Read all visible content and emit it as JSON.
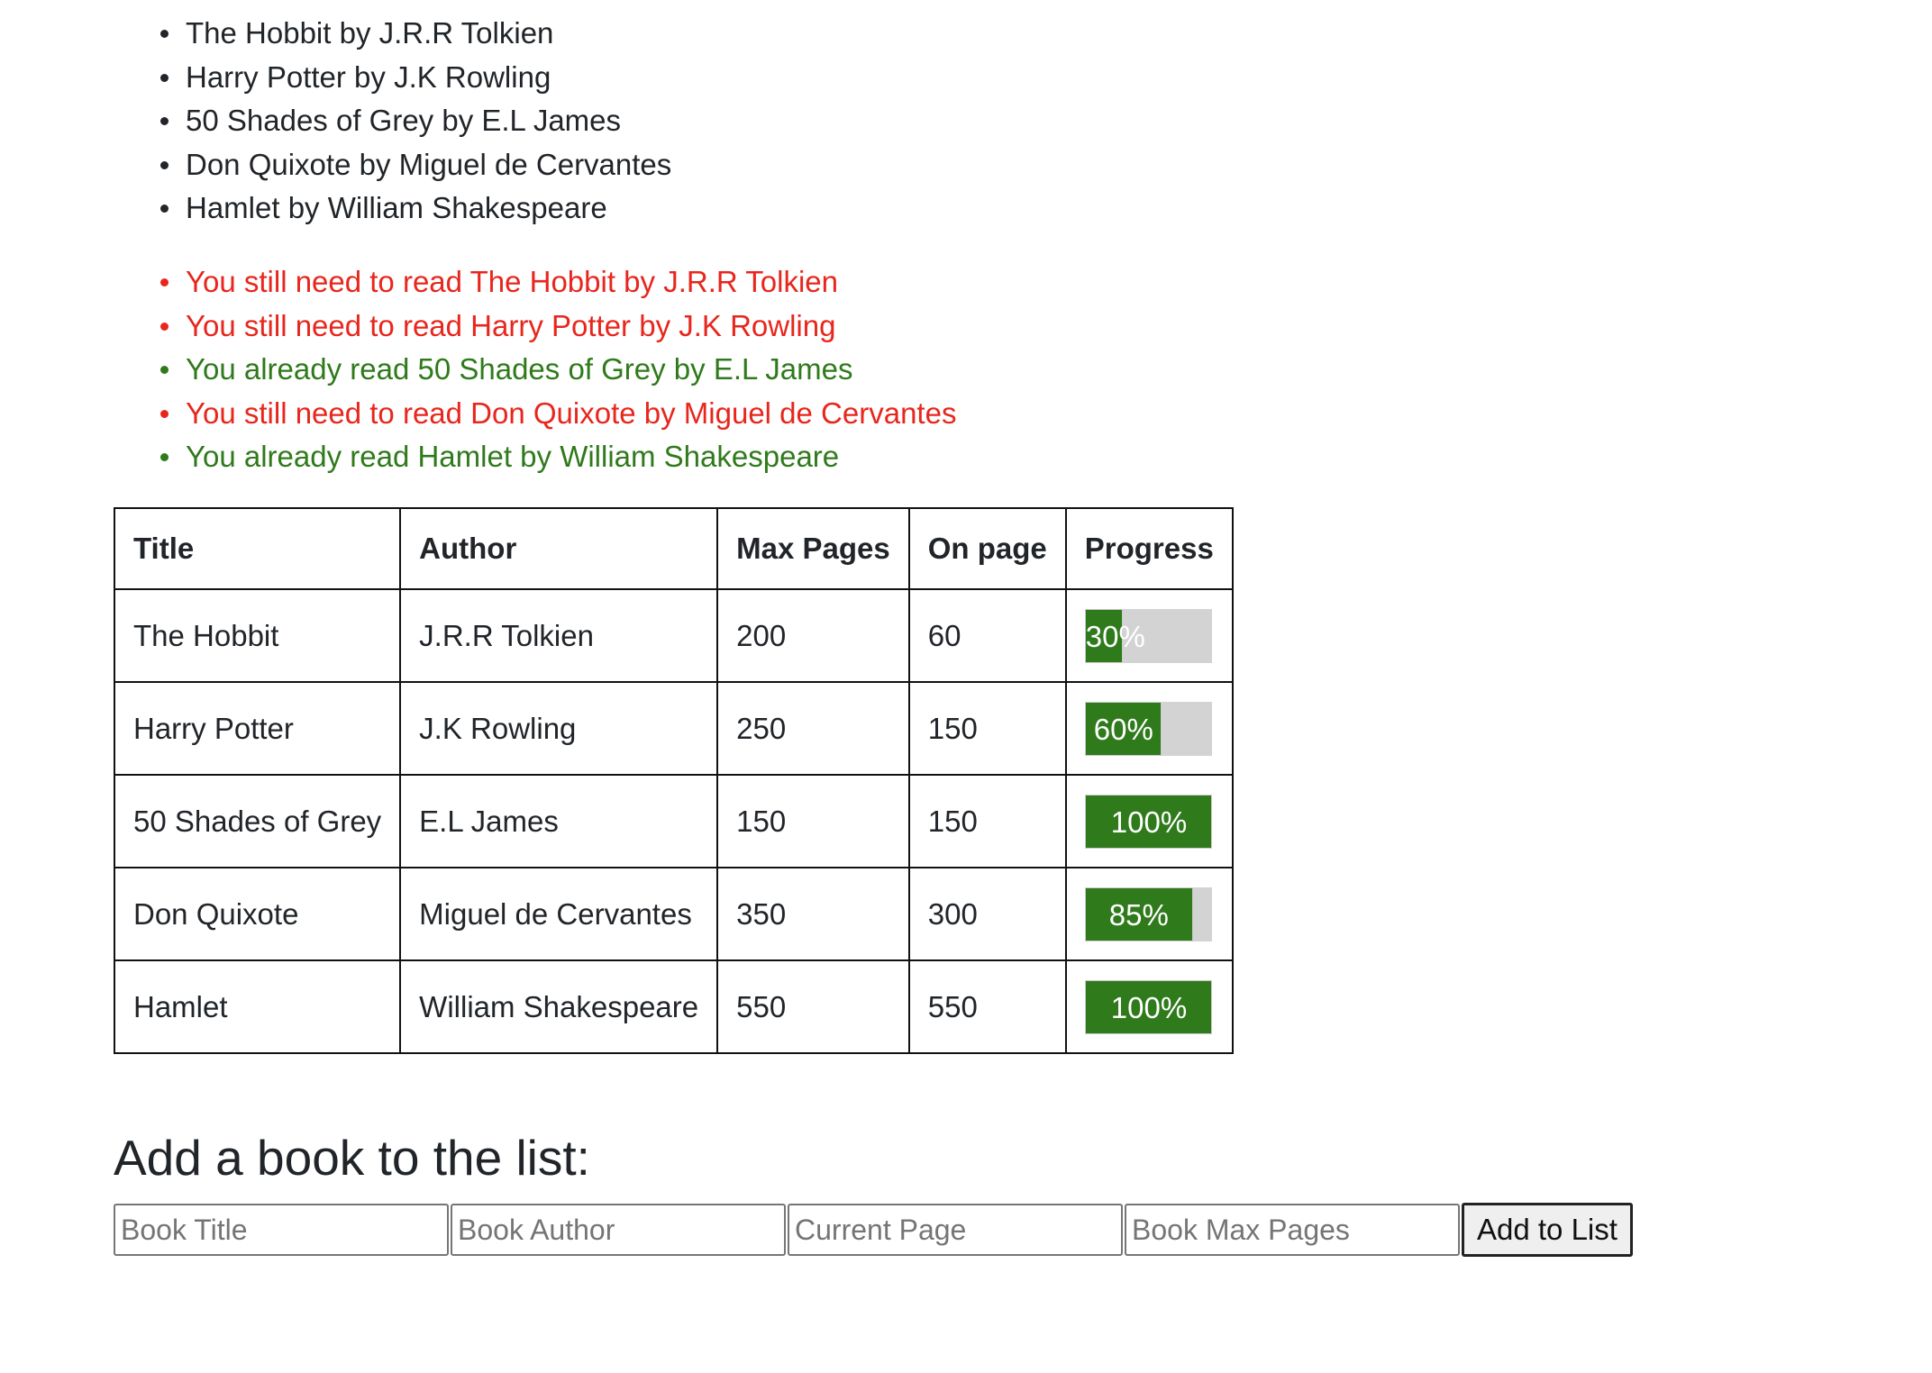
{
  "books_list": [
    "The Hobbit by J.R.R Tolkien",
    "Harry Potter by J.K Rowling",
    "50 Shades of Grey by E.L James",
    "Don Quixote by Miguel de Cervantes",
    "Hamlet by William Shakespeare"
  ],
  "status_list": [
    {
      "text": "You still need to read The Hobbit by J.R.R Tolkien",
      "read": false
    },
    {
      "text": "You still need to read Harry Potter by J.K Rowling",
      "read": false
    },
    {
      "text": "You already read 50 Shades of Grey by E.L James",
      "read": true
    },
    {
      "text": "You still need to read Don Quixote by Miguel de Cervantes",
      "read": false
    },
    {
      "text": "You already read Hamlet by William Shakespeare",
      "read": true
    }
  ],
  "colors": {
    "unread": "#e8261d",
    "read": "#2f7a1b",
    "progress_fill": "#2f7a1b",
    "progress_track": "#d3d3d3"
  },
  "table": {
    "headers": {
      "title": "Title",
      "author": "Author",
      "max_pages": "Max Pages",
      "on_page": "On page",
      "progress": "Progress"
    },
    "rows": [
      {
        "title": "The Hobbit",
        "author": "J.R.R Tolkien",
        "max_pages": "200",
        "on_page": "60",
        "progress": 30,
        "progress_label": "30%"
      },
      {
        "title": "Harry Potter",
        "author": "J.K Rowling",
        "max_pages": "250",
        "on_page": "150",
        "progress": 60,
        "progress_label": "60%"
      },
      {
        "title": "50 Shades of Grey",
        "author": "E.L James",
        "max_pages": "150",
        "on_page": "150",
        "progress": 100,
        "progress_label": "100%"
      },
      {
        "title": "Don Quixote",
        "author": "Miguel de Cervantes",
        "max_pages": "350",
        "on_page": "300",
        "progress": 85,
        "progress_label": "85%"
      },
      {
        "title": "Hamlet",
        "author": "William Shakespeare",
        "max_pages": "550",
        "on_page": "550",
        "progress": 100,
        "progress_label": "100%"
      }
    ]
  },
  "form": {
    "heading": "Add a book to the list:",
    "title_placeholder": "Book Title",
    "author_placeholder": "Book Author",
    "current_page_placeholder": "Current Page",
    "max_pages_placeholder": "Book Max Pages",
    "submit_label": "Add to List"
  }
}
